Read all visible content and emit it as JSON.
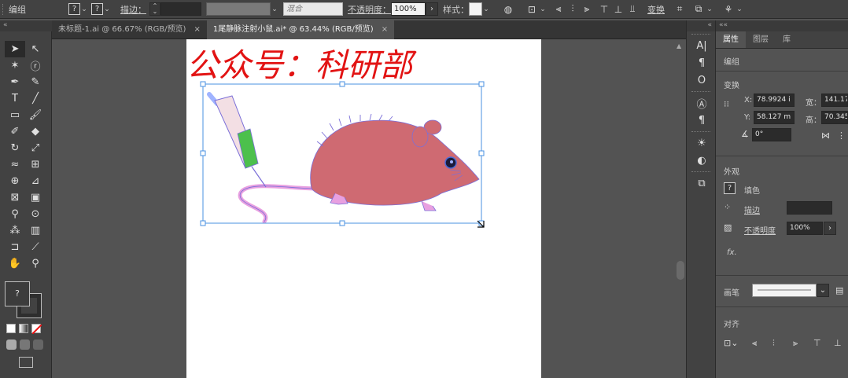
{
  "control_bar": {
    "selection_label": "编组",
    "fill_question": "?",
    "stroke_question": "?",
    "stroke_label": "描边：",
    "blend_mode": "混合",
    "opacity_label": "不透明度：",
    "opacity_value": "100%",
    "style_label": "样式：",
    "transform_label": "变换"
  },
  "tabs": [
    {
      "label": "未标题-1.ai @ 66.67% (RGB/预览)",
      "close": "×"
    },
    {
      "label": "1尾静脉注射小鼠.ai* @ 63.44% (RGB/预览)",
      "close": "×"
    }
  ],
  "canvas": {
    "title_text": "公众号：科研部",
    "title_color": "#e21313",
    "mouse_body_color": "#cf6a72",
    "selection_color": "#4a90e2",
    "syringe_liquid_color": "#4cc04c",
    "tail_color": "#e8a0e0"
  },
  "toolbar": {
    "fill_question": "?",
    "collapse": "«"
  },
  "properties": {
    "tabs": [
      "属性",
      "图层",
      "库"
    ],
    "group_label": "编组",
    "transform_label": "变换",
    "x_label": "X:",
    "x_value": "78.9924 i",
    "width_label": "宽：",
    "width_value": "141.17",
    "y_label": "Y:",
    "y_value": "58.127 m",
    "height_label": "高：",
    "height_value": "70.345",
    "angle_value": "0°",
    "appearance_label": "外观",
    "fill_label": "填色",
    "stroke_label": "描边",
    "opacity_label": "不透明度",
    "opacity_value": "100%",
    "fx_label": "fx.",
    "brush_label": "画笔",
    "align_label": "对齐"
  }
}
